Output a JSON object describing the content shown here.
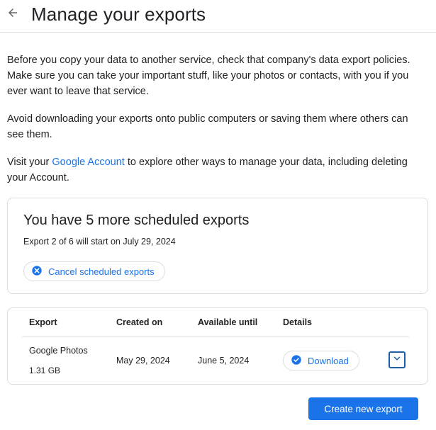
{
  "header": {
    "back_icon": "arrow-back-icon",
    "title": "Manage your exports"
  },
  "intro": {
    "p1": "Before you copy your data to another service, check that company's data export policies. Make sure you can take your important stuff, like your photos or contacts, with you if you ever want to leave that service.",
    "p2": "Avoid downloading your exports onto public computers or saving them where others can see them.",
    "p3_before": "Visit your ",
    "p3_link": "Google Account",
    "p3_after": " to explore other ways to manage your data, including deleting your Account."
  },
  "scheduled": {
    "title": "You have 5 more scheduled exports",
    "subtitle": "Export 2 of 6 will start on July 29, 2024",
    "cancel_label": "Cancel scheduled exports",
    "cancel_icon": "cancel-circle-icon"
  },
  "exports_table": {
    "headers": {
      "export": "Export",
      "created_on": "Created on",
      "available_until": "Available until",
      "details": "Details"
    },
    "rows": [
      {
        "name": "Google Photos",
        "size": "1.31 GB",
        "created_on": "May 29, 2024",
        "available_until": "June 5, 2024",
        "download_label": "Download",
        "download_icon": "check-circle-icon",
        "expand_icon": "chevron-down-icon"
      }
    ]
  },
  "actions": {
    "create_label": "Create new export"
  },
  "colors": {
    "accent": "#1a73e8",
    "border": "#dadce0",
    "text": "#202124"
  }
}
